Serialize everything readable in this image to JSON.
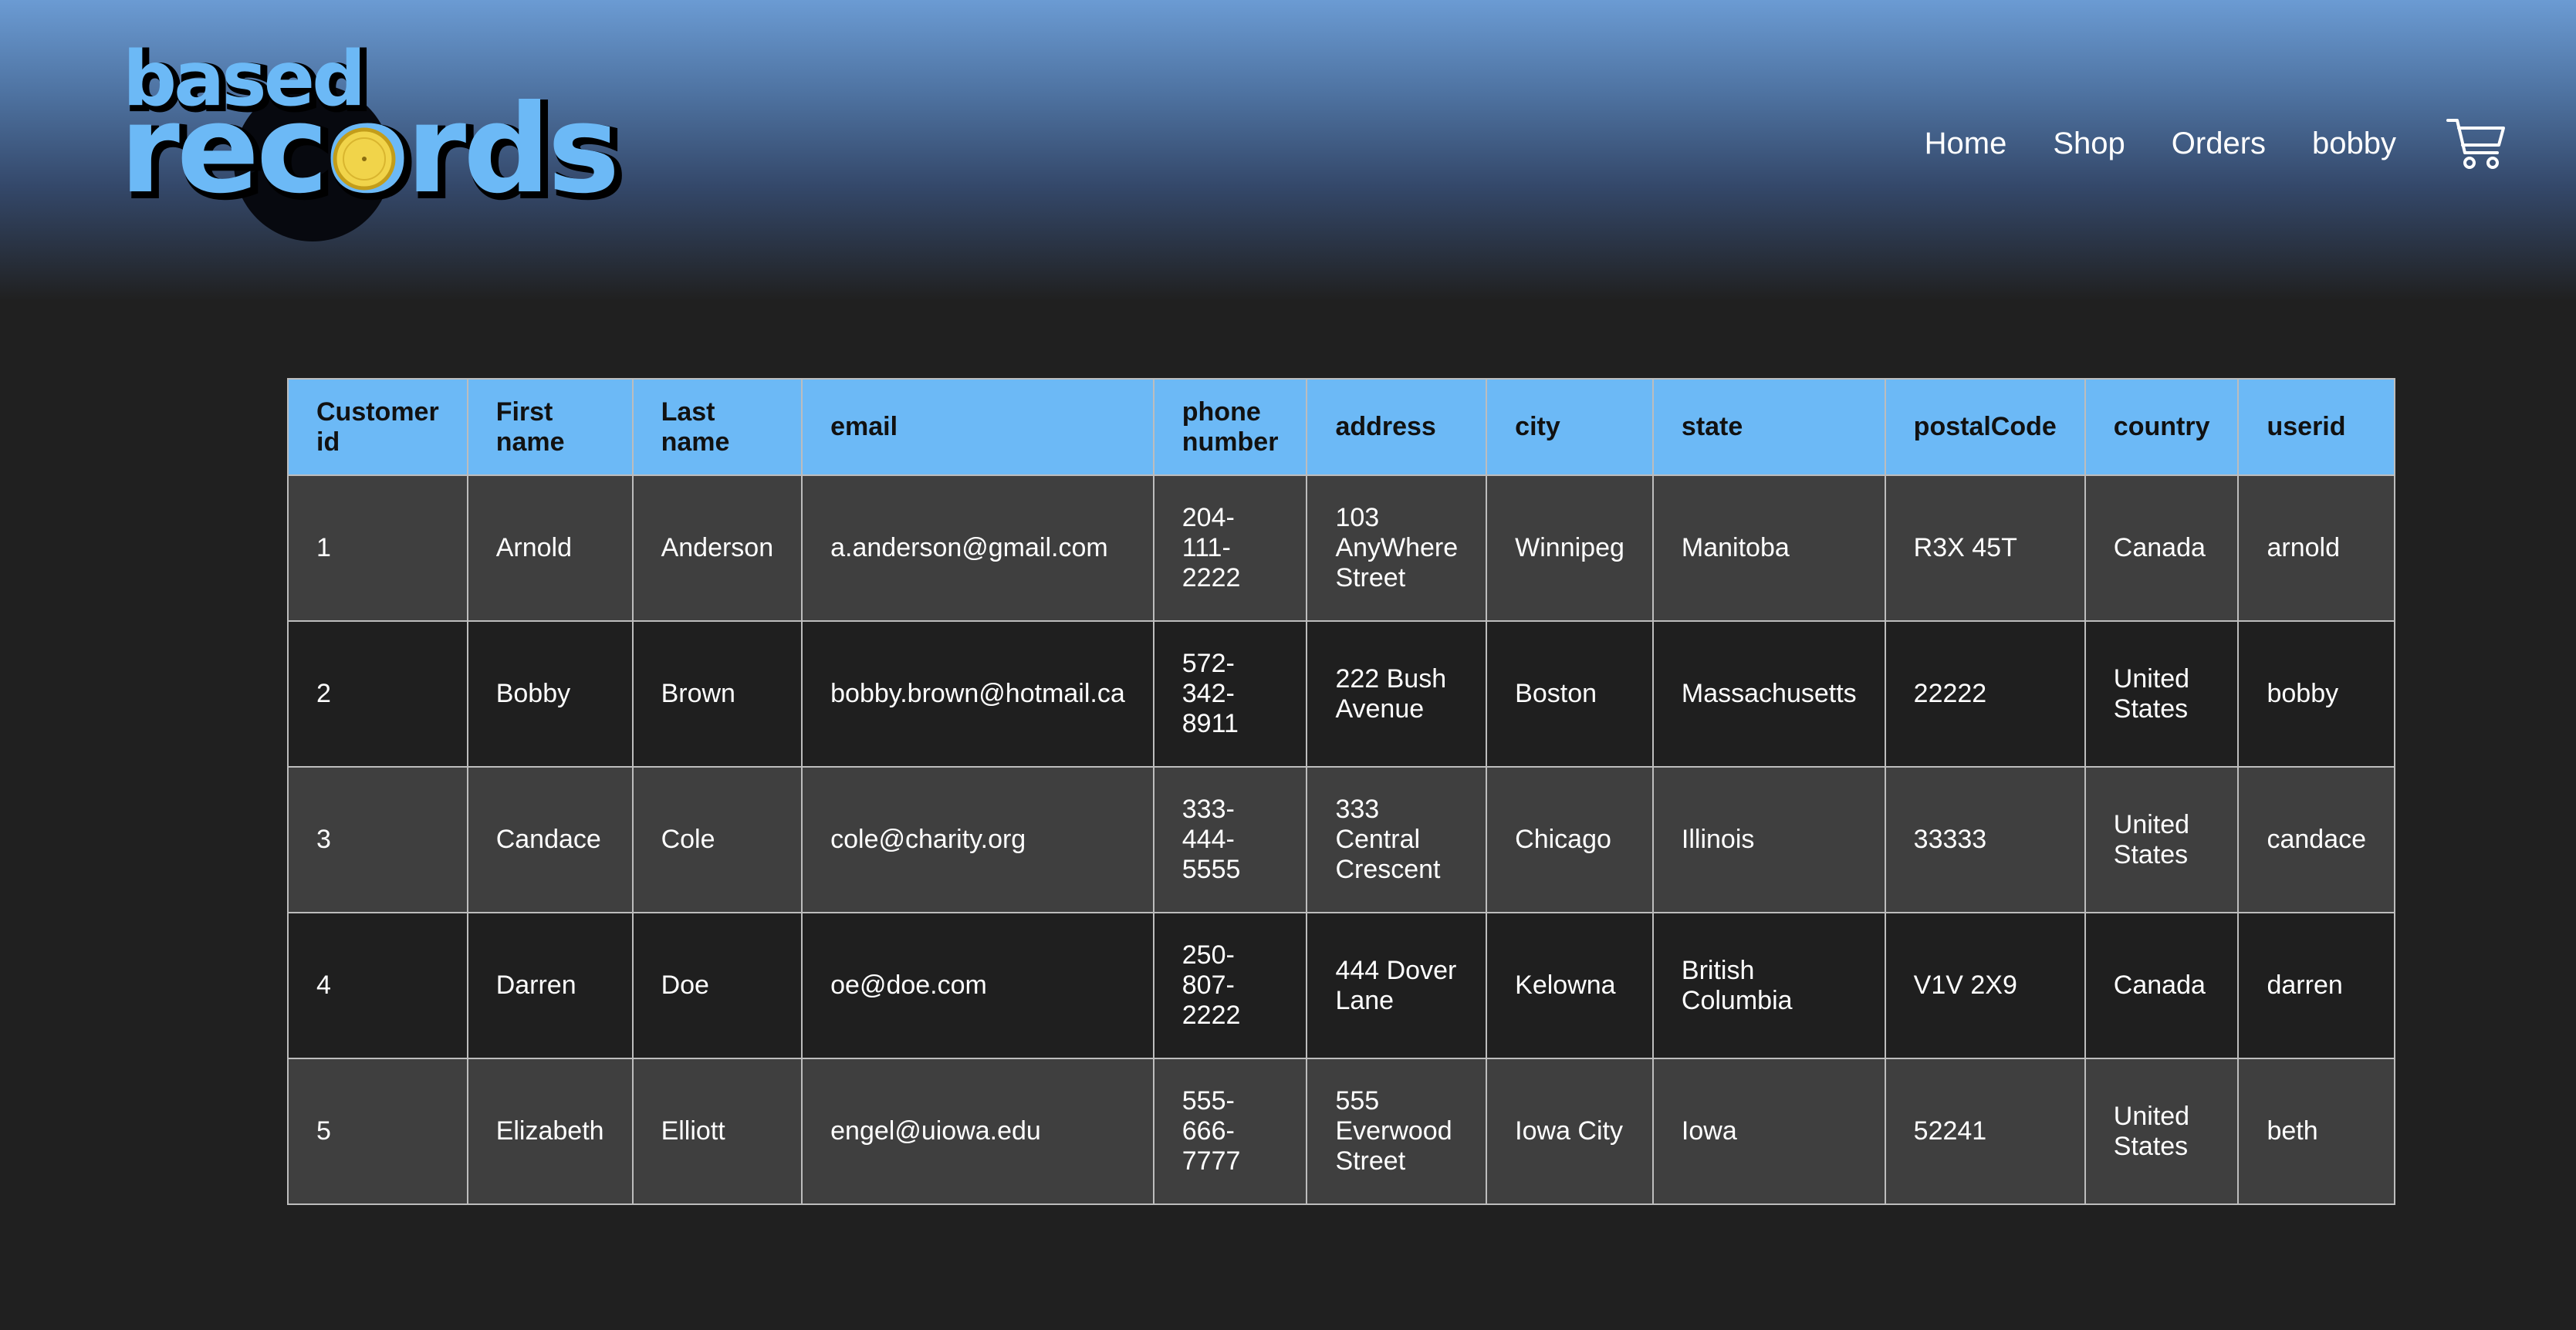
{
  "brand": {
    "line1": "based",
    "line2": "records"
  },
  "nav": {
    "home": "Home",
    "shop": "Shop",
    "orders": "Orders",
    "user": "bobby"
  },
  "icons": {
    "cart": "shopping-cart-icon"
  },
  "colors": {
    "accent": "#6cb9f6",
    "background": "#202020",
    "record_label": "#f1d44a"
  },
  "table": {
    "headers": [
      "Customer id",
      "First name",
      "Last name",
      "email",
      "phone number",
      "address",
      "city",
      "state",
      "postalCode",
      "country",
      "userid"
    ],
    "rows": [
      [
        "1",
        "Arnold",
        "Anderson",
        "a.anderson@gmail.com",
        "204-111-2222",
        "103 AnyWhere Street",
        "Winnipeg",
        "Manitoba",
        "R3X 45T",
        "Canada",
        "arnold"
      ],
      [
        "2",
        "Bobby",
        "Brown",
        "bobby.brown@hotmail.ca",
        "572-342-8911",
        "222 Bush Avenue",
        "Boston",
        "Massachusetts",
        "22222",
        "United States",
        "bobby"
      ],
      [
        "3",
        "Candace",
        "Cole",
        "cole@charity.org",
        "333-444-5555",
        "333 Central Crescent",
        "Chicago",
        "Illinois",
        "33333",
        "United States",
        "candace"
      ],
      [
        "4",
        "Darren",
        "Doe",
        "oe@doe.com",
        "250-807-2222",
        "444 Dover Lane",
        "Kelowna",
        "British Columbia",
        "V1V 2X9",
        "Canada",
        "darren"
      ],
      [
        "5",
        "Elizabeth",
        "Elliott",
        "engel@uiowa.edu",
        "555-666-7777",
        "555 Everwood Street",
        "Iowa City",
        "Iowa",
        "52241",
        "United States",
        "beth"
      ]
    ]
  }
}
